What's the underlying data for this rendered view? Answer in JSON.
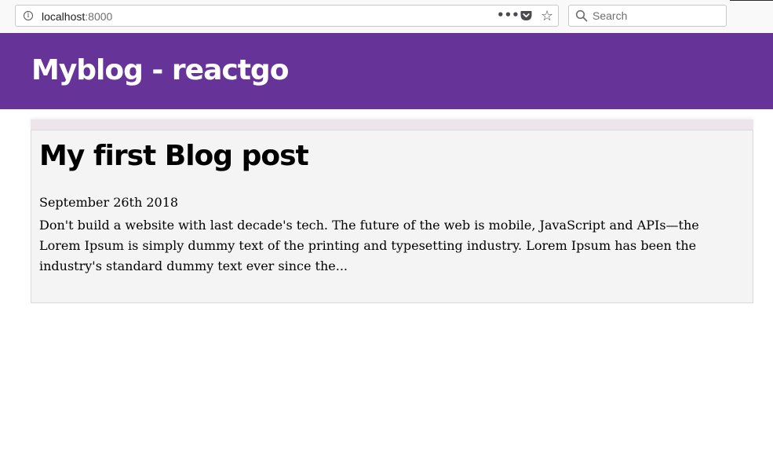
{
  "browser": {
    "url_host": "localhost",
    "url_port": ":8000",
    "search_placeholder": "Search",
    "icons": {
      "info": "info-icon",
      "more": "more-icon",
      "pocket": "pocket-icon",
      "bookmark": "star-icon",
      "search": "search-icon"
    }
  },
  "site": {
    "title": "Myblog - reactgo",
    "header_color": "#663399"
  },
  "posts": [
    {
      "title": "My first Blog post",
      "date": "September 26th 2018",
      "excerpt": "Don't build a website with last decade's tech. The future of the web is mobile, JavaScript and APIs—the Lorem Ipsum is simply dummy text of the printing and typesetting industry. Lorem Ipsum has been the industry's standard dummy text ever since the..."
    }
  ]
}
